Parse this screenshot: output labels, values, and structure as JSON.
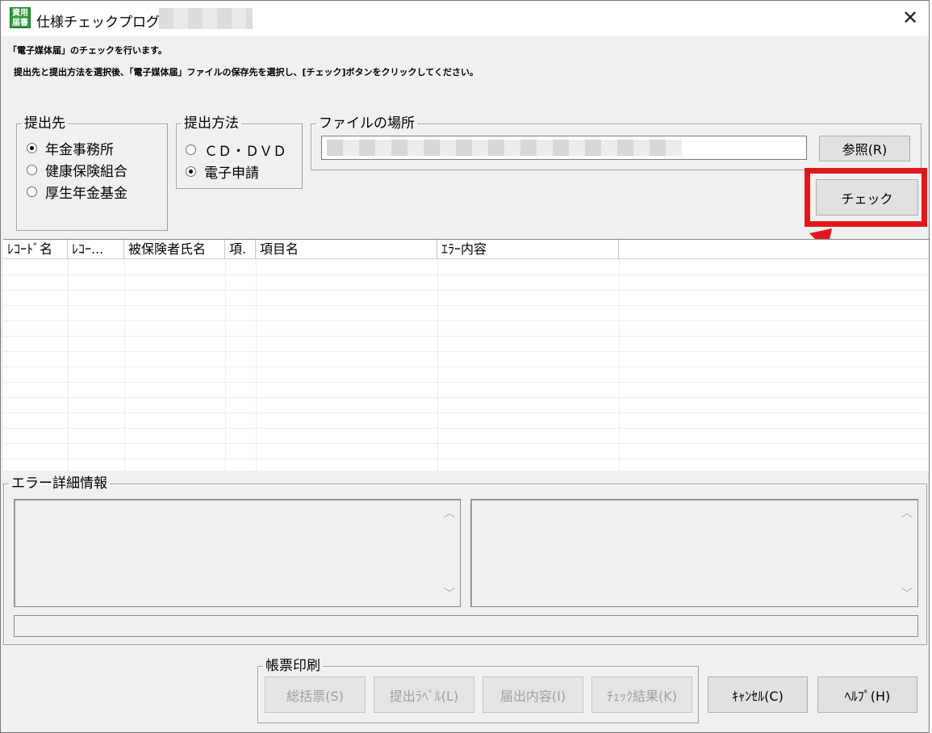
{
  "window": {
    "app_icon_text": "資用届書",
    "title": "仕様チェックプログラム",
    "close_glyph": "✕"
  },
  "messages": {
    "line1": "「電子媒体届」のチェックを行います。",
    "line2": "提出先と提出方法を選択後、「電子媒体届」ファイルの保存先を選択し、[チェック]ボタンをクリックしてください。"
  },
  "destination": {
    "legend": "提出先",
    "options": [
      {
        "label": "年金事務所",
        "checked": true
      },
      {
        "label": "健康保険組合",
        "checked": false
      },
      {
        "label": "厚生年金基金",
        "checked": false
      }
    ]
  },
  "method": {
    "legend": "提出方法",
    "options": [
      {
        "label": "ＣＤ・ＤＶＤ",
        "checked": false
      },
      {
        "label": "電子申請",
        "checked": true
      }
    ]
  },
  "file_location": {
    "legend": "ファイルの場所",
    "value": "",
    "browse_label": "参照(R)"
  },
  "check_button": {
    "label": "チェック",
    "highlight_color": "#e0181d"
  },
  "table": {
    "columns": [
      "ﾚｺｰﾄﾞ名",
      "ﾚｺｰ...",
      "被保険者氏名",
      "項.",
      "項目名",
      "ｴﾗｰ内容",
      ""
    ]
  },
  "error_details": {
    "legend": "エラー詳細情報"
  },
  "report_print": {
    "legend": "帳票印刷",
    "buttons": [
      "総括票(S)",
      "提出ﾗﾍﾞﾙ(L)",
      "届出内容(I)",
      "ﾁｪｯｸ結果(K)"
    ]
  },
  "footer": {
    "cancel_label": "ｷｬﾝｾﾙ(C)",
    "help_label": "ﾍﾙﾌﾟ(H)"
  }
}
